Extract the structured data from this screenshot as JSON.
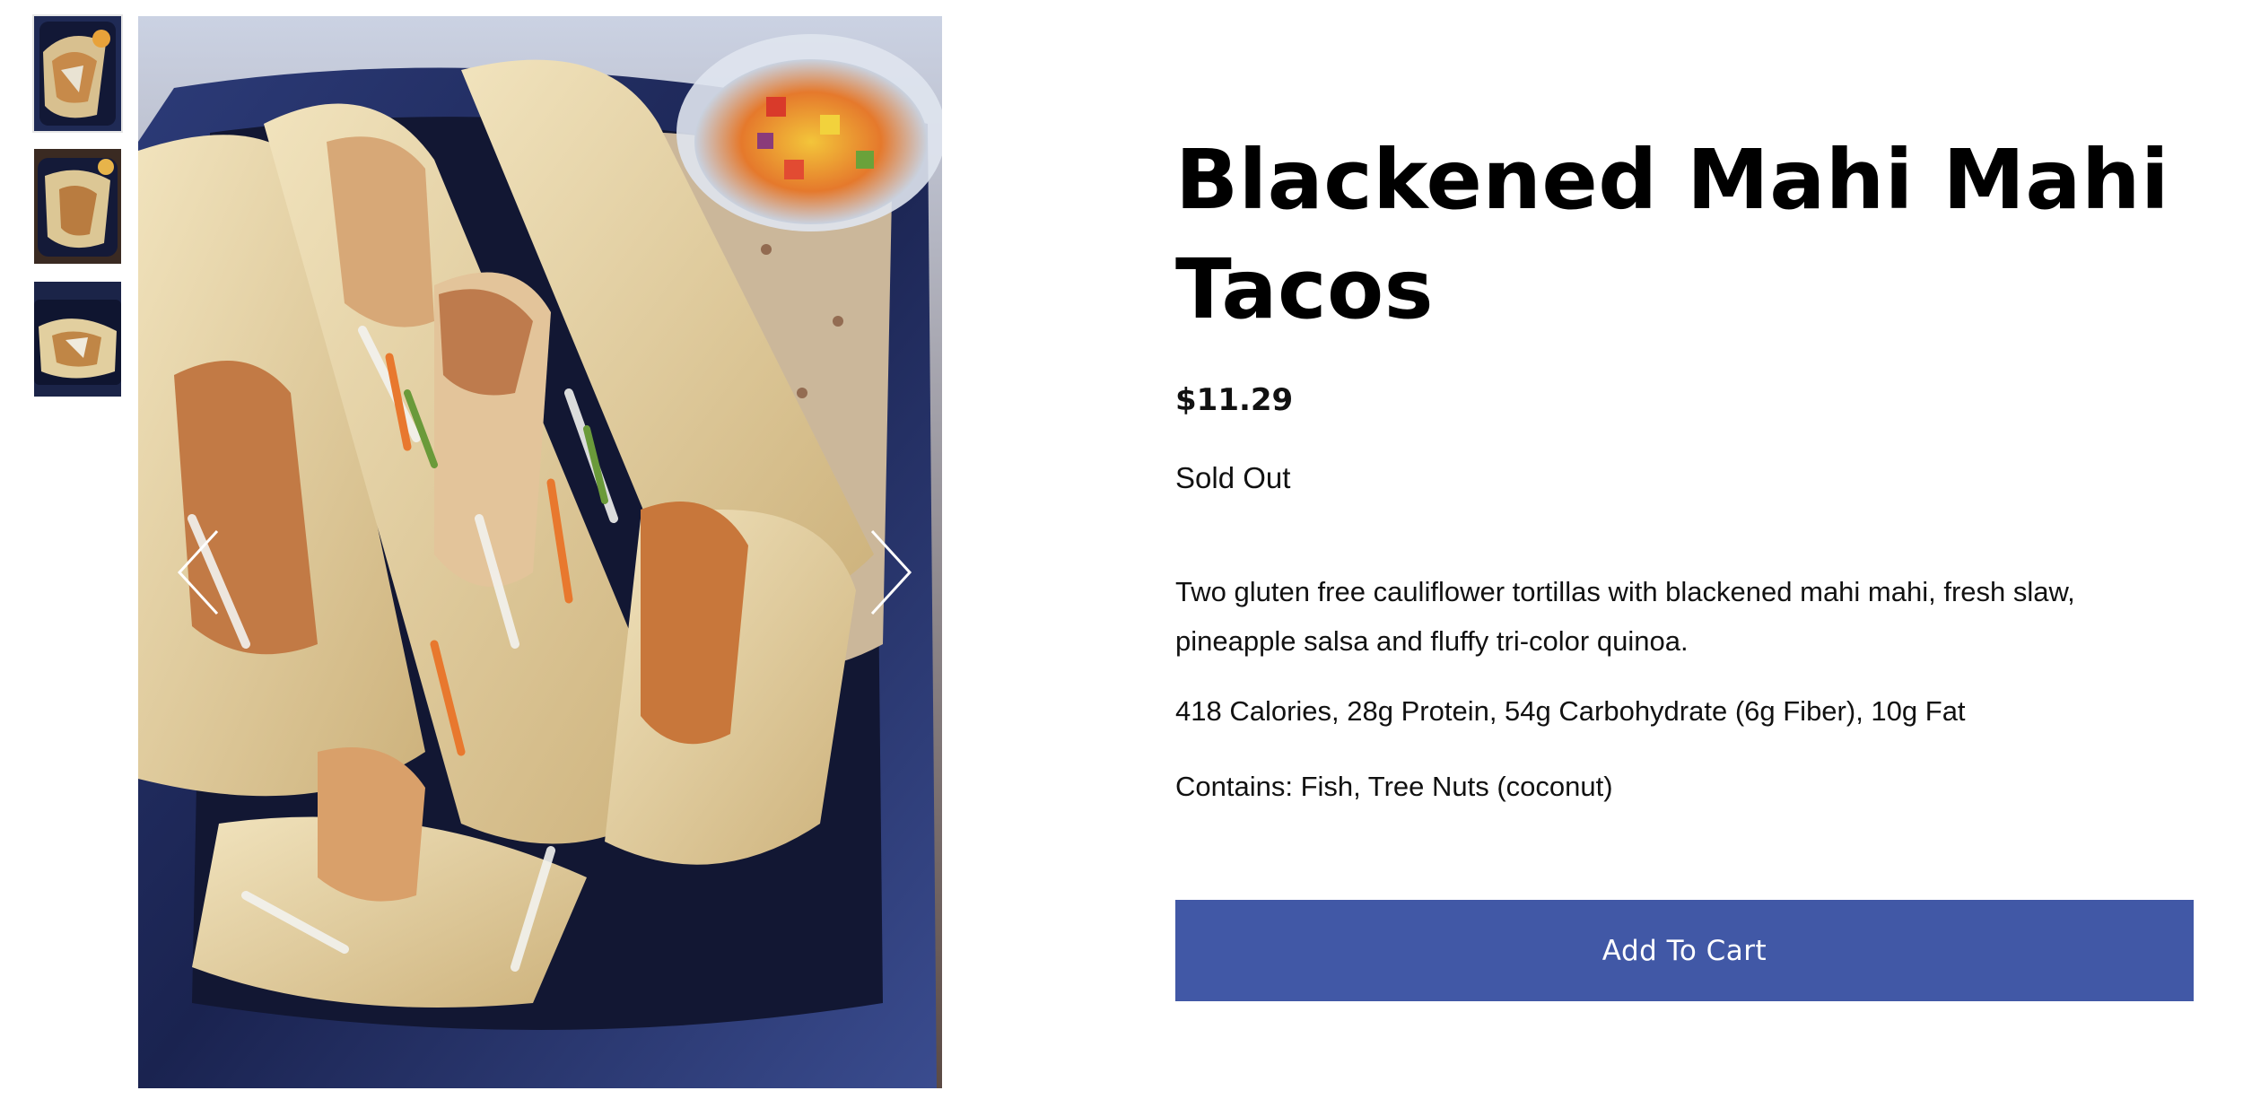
{
  "product": {
    "title_line1": "Blackened Mahi Mahi",
    "title_line2": "Tacos",
    "price": "$11.29",
    "stock_status": "Sold Out",
    "description": "Two gluten free cauliflower tortillas with blackened mahi mahi, fresh slaw, pineapple salsa and fluffy tri-color quinoa.",
    "nutrition": "418 Calories, 28g Protein, 54g Carbohydrate (6g Fiber), 10g Fat",
    "allergens": "Contains: Fish, Tree Nuts (coconut)",
    "add_to_cart_label": "Add To Cart"
  },
  "gallery": {
    "thumbnail_count": 3,
    "active_index": 0,
    "prev_icon": "chevron-left-icon",
    "next_icon": "chevron-right-icon"
  },
  "colors": {
    "accent": "#4158a6",
    "text": "#111111",
    "background": "#ffffff",
    "container": "#1e2a55"
  }
}
